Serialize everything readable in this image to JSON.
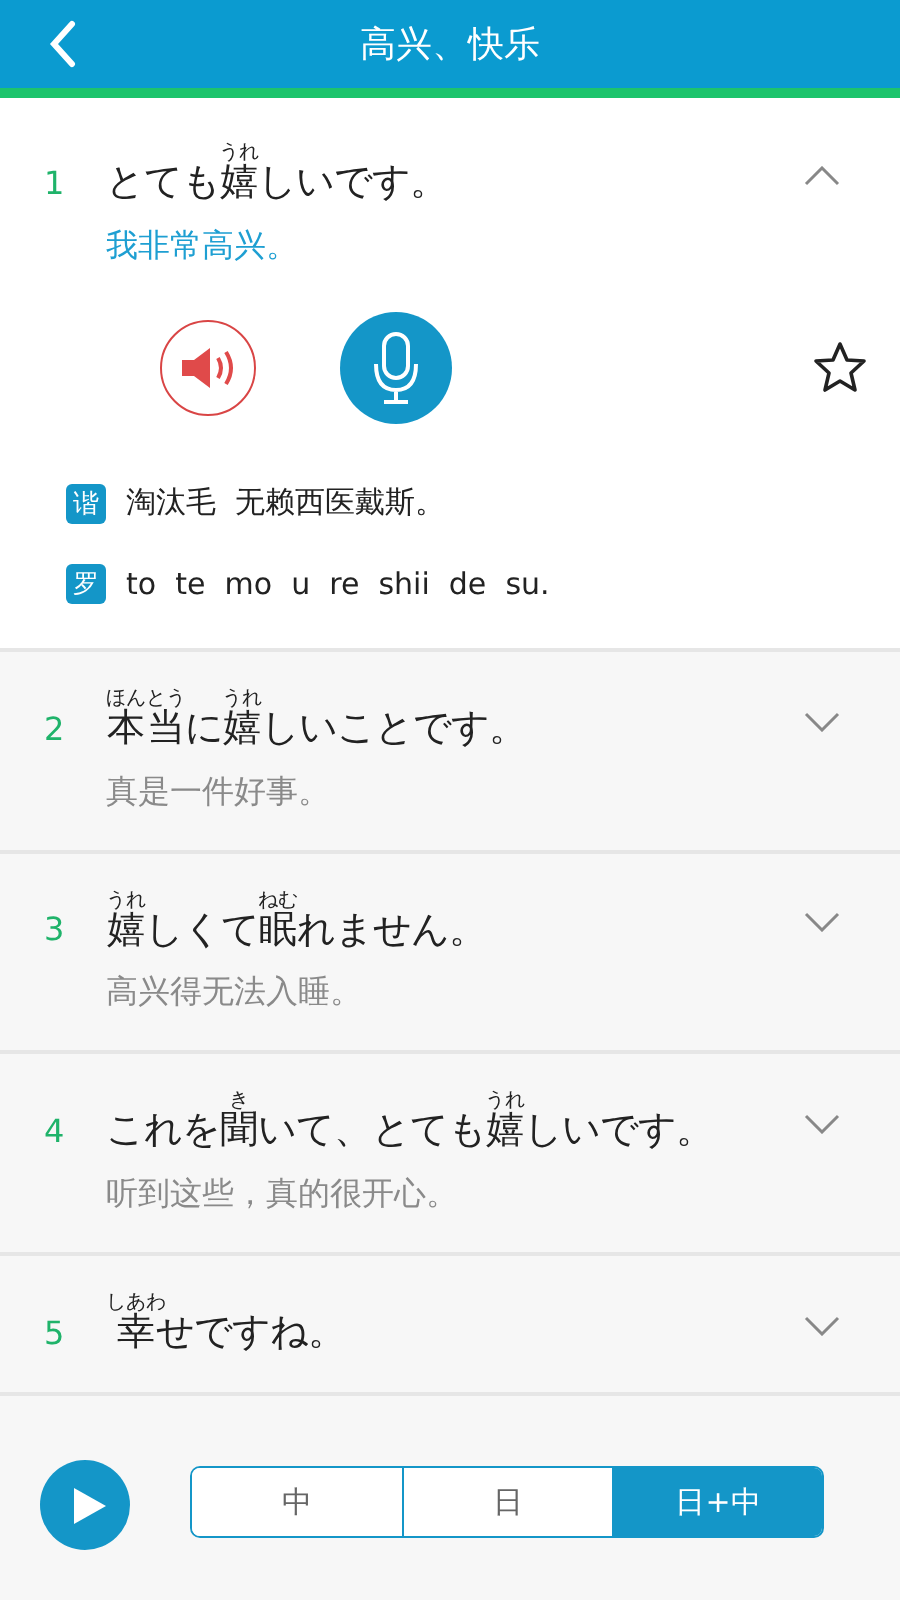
{
  "header": {
    "title": "高兴、快乐"
  },
  "sentences": [
    {
      "number": "1",
      "expanded": true,
      "favorite": false,
      "segments": [
        {
          "text": "とても"
        },
        {
          "text": "嬉",
          "ruby": "うれ"
        },
        {
          "text": "しいです。"
        }
      ],
      "translation": "我非常高兴。",
      "readings": [
        {
          "badge": "谐",
          "text": "淘汰毛  无赖西医戴斯。"
        },
        {
          "badge": "罗",
          "text": "to  te  mo  u  re  shii  de  su."
        }
      ]
    },
    {
      "number": "2",
      "expanded": false,
      "segments": [
        {
          "text": "本当",
          "ruby": "ほんとう"
        },
        {
          "text": "に"
        },
        {
          "text": "嬉",
          "ruby": "うれ"
        },
        {
          "text": "しいことです。"
        }
      ],
      "translation": "真是一件好事。"
    },
    {
      "number": "3",
      "expanded": false,
      "segments": [
        {
          "text": "嬉",
          "ruby": "うれ"
        },
        {
          "text": "しくて"
        },
        {
          "text": "眠",
          "ruby": "ねむ"
        },
        {
          "text": "れません。"
        }
      ],
      "translation": "高兴得无法入睡。"
    },
    {
      "number": "4",
      "expanded": false,
      "segments": [
        {
          "text": "これを"
        },
        {
          "text": "聞",
          "ruby": "き"
        },
        {
          "text": "いて、とても"
        },
        {
          "text": "嬉",
          "ruby": "うれ"
        },
        {
          "text": "しいです。"
        }
      ],
      "translation": "听到这些，真的很开心。"
    },
    {
      "number": "5",
      "expanded": false,
      "segments": [
        {
          "text": "幸",
          "ruby": "しあわ"
        },
        {
          "text": "せですね。"
        }
      ]
    }
  ],
  "modes": [
    {
      "label": "中",
      "selected": false
    },
    {
      "label": "日",
      "selected": false
    },
    {
      "label": "日+中",
      "selected": true
    }
  ]
}
